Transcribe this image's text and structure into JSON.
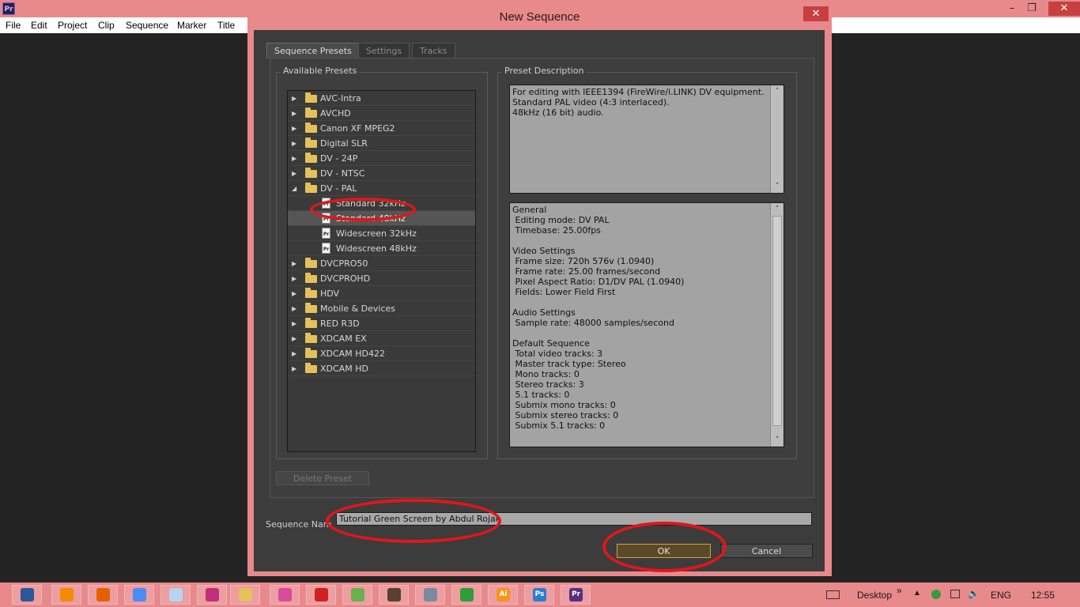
{
  "app": {
    "icon_label": "Pr",
    "menu": [
      "File",
      "Edit",
      "Project",
      "Clip",
      "Sequence",
      "Marker",
      "Title"
    ]
  },
  "dialog": {
    "title": "New Sequence",
    "tabs": [
      "Sequence Presets",
      "Settings",
      "Tracks"
    ],
    "active_tab": "Sequence Presets",
    "available_presets_label": "Available Presets",
    "preset_description_label": "Preset Description",
    "presets": [
      {
        "label": "AVC-Intra",
        "kind": "folder",
        "expanded": false
      },
      {
        "label": "AVCHD",
        "kind": "folder",
        "expanded": false
      },
      {
        "label": "Canon XF MPEG2",
        "kind": "folder",
        "expanded": false
      },
      {
        "label": "Digital SLR",
        "kind": "folder",
        "expanded": false
      },
      {
        "label": "DV - 24P",
        "kind": "folder",
        "expanded": false
      },
      {
        "label": "DV - NTSC",
        "kind": "folder",
        "expanded": false
      },
      {
        "label": "DV - PAL",
        "kind": "folder",
        "expanded": true
      },
      {
        "label": "Standard 32kHz",
        "kind": "preset"
      },
      {
        "label": "Standard 48kHz",
        "kind": "preset",
        "selected": true
      },
      {
        "label": "Widescreen 32kHz",
        "kind": "preset"
      },
      {
        "label": "Widescreen 48kHz",
        "kind": "preset"
      },
      {
        "label": "DVCPRO50",
        "kind": "folder",
        "expanded": false
      },
      {
        "label": "DVCPROHD",
        "kind": "folder",
        "expanded": false
      },
      {
        "label": "HDV",
        "kind": "folder",
        "expanded": false
      },
      {
        "label": "Mobile & Devices",
        "kind": "folder",
        "expanded": false
      },
      {
        "label": "RED R3D",
        "kind": "folder",
        "expanded": false
      },
      {
        "label": "XDCAM EX",
        "kind": "folder",
        "expanded": false
      },
      {
        "label": "XDCAM HD422",
        "kind": "folder",
        "expanded": false
      },
      {
        "label": "XDCAM HD",
        "kind": "folder",
        "expanded": false
      }
    ],
    "description_lines": [
      "For editing with IEEE1394 (FireWire/i.LINK) DV equipment.",
      "Standard PAL video (4:3 interlaced).",
      "48kHz (16 bit) audio."
    ],
    "details_lines": [
      "General",
      " Editing mode: DV PAL",
      " Timebase: 25.00fps",
      "",
      "Video Settings",
      " Frame size: 720h 576v (1.0940)",
      " Frame rate: 25.00 frames/second",
      " Pixel Aspect Ratio: D1/DV PAL (1.0940)",
      " Fields: Lower Field First",
      "",
      "Audio Settings",
      " Sample rate: 48000 samples/second",
      "",
      "Default Sequence",
      " Total video tracks: 3",
      " Master track type: Stereo",
      " Mono tracks: 0",
      " Stereo tracks: 3",
      " 5.1 tracks: 0",
      " Submix mono tracks: 0",
      " Submix stereo tracks: 0",
      " Submix 5.1 tracks: 0"
    ],
    "delete_preset_label": "Delete Preset",
    "sequence_name_label": "Sequence Nam",
    "sequence_name_value": "Tutorial Green Screen by Abdul Rojak",
    "ok_label": "OK",
    "cancel_label": "Cancel"
  },
  "taskbar": {
    "apps": [
      "word-icon",
      "vlc-icon",
      "firefox-icon",
      "chrome-icon",
      "notepad-icon",
      "app-icon",
      "explorer-icon",
      "paint-icon",
      "opera-icon",
      "torrent-icon",
      "archive-icon",
      "tool-icon",
      "android-icon",
      "illustrator-icon",
      "photoshop-icon",
      "premiere-icon"
    ],
    "app_glyphs": {
      "illustrator-icon": "Ai",
      "photoshop-icon": "Ps",
      "premiere-icon": "Pr"
    },
    "desktop_label": "Desktop",
    "chevron": "»",
    "language": "ENG",
    "time": "12:55"
  },
  "colors": {
    "chrome_pink": "#e8898c",
    "annotation_red": "#e1161b",
    "folder_yellow": "#e3c15b",
    "ok_border": "#d7a33e"
  }
}
